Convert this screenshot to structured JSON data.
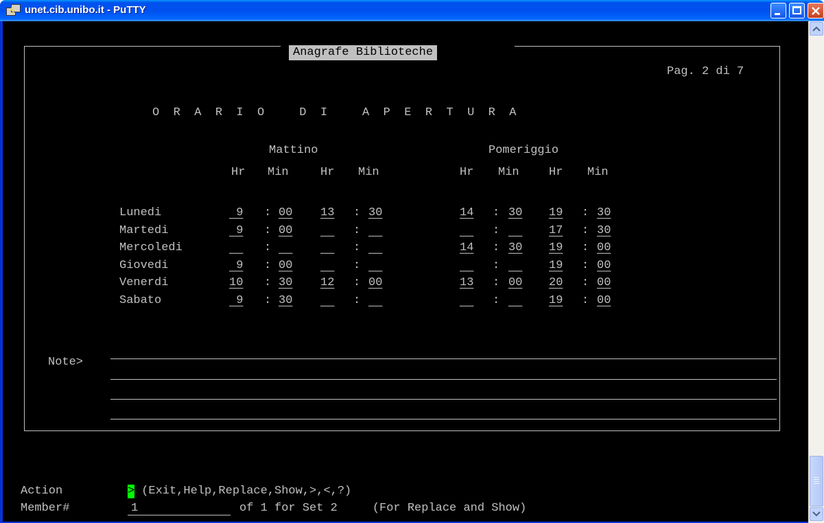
{
  "window": {
    "title": "unet.cib.unibo.it - PuTTY"
  },
  "screen": {
    "title": "Anagrafe Biblioteche",
    "page": "Pag. 2 di 7",
    "heading": "O  R  A  R  I  O     D  I     A  P  E  R  T  U  R  A",
    "mattino": "Mattino",
    "pomeriggio": "Pomeriggio",
    "hr": "Hr",
    "min": "Min",
    "days": [
      {
        "name": "Lunedi",
        "m_hr1": " 9",
        "m_min1": "00",
        "m_hr2": "13",
        "m_min2": "30",
        "p_hr1": "14",
        "p_min1": "30",
        "p_hr2": "19",
        "p_min2": "30"
      },
      {
        "name": "Martedi",
        "m_hr1": " 9",
        "m_min1": "00",
        "m_hr2": "  ",
        "m_min2": "  ",
        "p_hr1": "  ",
        "p_min1": "  ",
        "p_hr2": "17",
        "p_min2": "30"
      },
      {
        "name": "Mercoledi",
        "m_hr1": "  ",
        "m_min1": "  ",
        "m_hr2": "  ",
        "m_min2": "  ",
        "p_hr1": "14",
        "p_min1": "30",
        "p_hr2": "19",
        "p_min2": "00"
      },
      {
        "name": "Giovedi",
        "m_hr1": " 9",
        "m_min1": "00",
        "m_hr2": "  ",
        "m_min2": "  ",
        "p_hr1": "  ",
        "p_min1": "  ",
        "p_hr2": "19",
        "p_min2": "00"
      },
      {
        "name": "Venerdi",
        "m_hr1": "10",
        "m_min1": "30",
        "m_hr2": "12",
        "m_min2": "00",
        "p_hr1": "13",
        "p_min1": "00",
        "p_hr2": "20",
        "p_min2": "00"
      },
      {
        "name": "Sabato",
        "m_hr1": " 9",
        "m_min1": "30",
        "m_hr2": "  ",
        "m_min2": "  ",
        "p_hr1": "  ",
        "p_min1": "  ",
        "p_hr2": "19",
        "p_min2": "00"
      }
    ],
    "note_label": "Note>",
    "action_label": "Action",
    "action_value": ">",
    "action_options": " (Exit,Help,Replace,Show,>,<,?)",
    "member_label": "Member#",
    "member_value": "1",
    "member_suffix": "of 1 for Set 2     (For Replace and Show)"
  }
}
